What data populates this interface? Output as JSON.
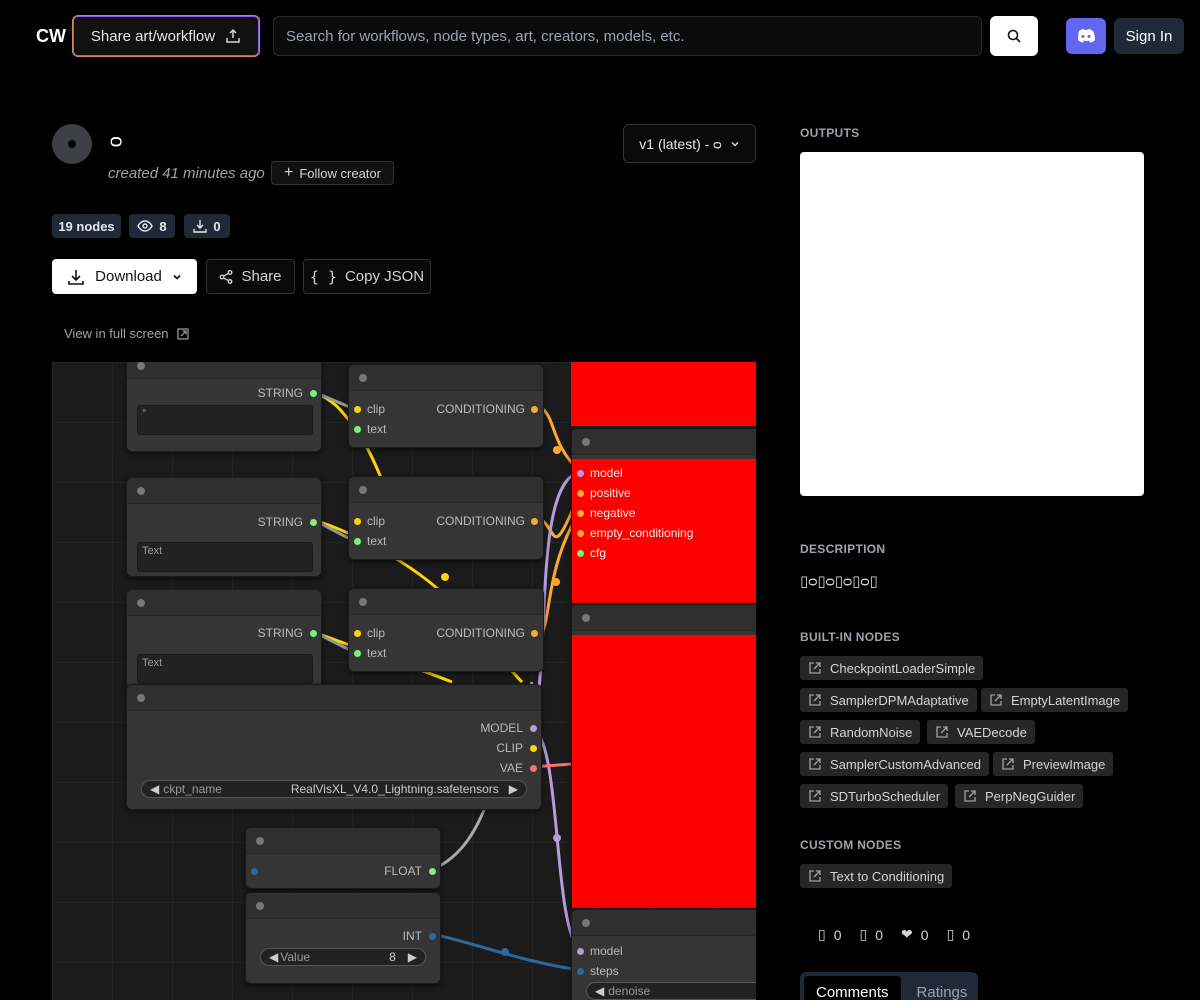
{
  "header": {
    "logo": "CW",
    "share_label": "Share art/workflow",
    "search_placeholder": "Search for workflows, node types, art, creators, models, etc.",
    "signin_label": "Sign In"
  },
  "workflow": {
    "title": "ᴑ",
    "created": "created 41 minutes ago",
    "follow_label": "Follow creator",
    "version": "v1 (latest) - ᴑ",
    "nodes_count": "19 nodes",
    "views": "8",
    "downloads": "0",
    "download_label": "Download",
    "share_label": "Share",
    "copy_json_label": "Copy JSON",
    "fullscreen_label": "View in full screen"
  },
  "canvas": {
    "string_label": "STRING",
    "clip_label": "clip",
    "text_label": "text",
    "conditioning_label": "CONDITIONING",
    "text_value_1": "°",
    "text_placeholder": "Text",
    "guider_inputs": [
      "model",
      "positive",
      "negative",
      "empty_conditioning",
      "cfg"
    ],
    "loader_outputs": [
      "MODEL",
      "CLIP",
      "VAE"
    ],
    "ckpt_label": "ckpt_name",
    "ckpt_value": "RealVisXL_V4.0_Lightning.safetensors",
    "float_label": "FLOAT",
    "int_label": "INT",
    "value_label": "Value",
    "value_num": "8",
    "sched_inputs": [
      "model",
      "steps"
    ],
    "denoise_label": "denoise"
  },
  "sidebar": {
    "outputs_title": "OUTPUTS",
    "description_title": "DESCRIPTION",
    "description": "▯ᴑ▯ᴑ▯ᴑ▯ᴑ▯",
    "builtin_title": "BUILT-IN NODES",
    "builtin_nodes": [
      "CheckpointLoaderSimple",
      "SamplerDPMAdaptative",
      "EmptyLatentImage",
      "RandomNoise",
      "VAEDecode",
      "SamplerCustomAdvanced",
      "PreviewImage",
      "SDTurboScheduler",
      "PerpNegGuider"
    ],
    "custom_title": "CUSTOM NODES",
    "custom_nodes": [
      "Text to Conditioning"
    ],
    "stats": [
      "0",
      "0",
      "0",
      "0"
    ],
    "tabs": [
      "Comments",
      "Ratings"
    ]
  },
  "colors": {
    "accent": "#6366f1",
    "clip_port": "#ffd500",
    "string_port": "#7bf27b",
    "conditioning_port": "#ffa931",
    "model_port": "#b39ddb",
    "vae_port": "#ff6e6e",
    "int_port": "#29699c",
    "output_node": "#ff0000"
  }
}
